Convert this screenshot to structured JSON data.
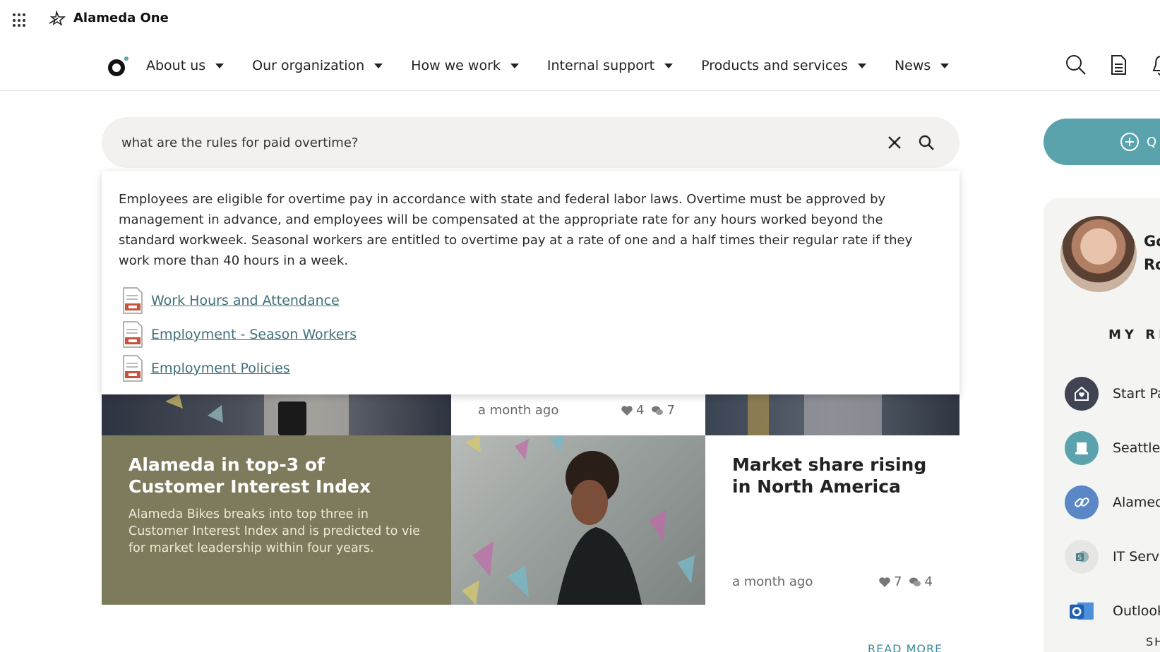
{
  "brand": {
    "name": "Alameda One"
  },
  "nav": {
    "items": [
      {
        "label": "About us"
      },
      {
        "label": "Our organization"
      },
      {
        "label": "How we work"
      },
      {
        "label": "Internal support"
      },
      {
        "label": "Products and services"
      },
      {
        "label": "News"
      }
    ],
    "icons": [
      "search-icon",
      "document-icon",
      "bell-icon"
    ]
  },
  "search": {
    "query": "what are the rules for paid overtime?",
    "answer": "Employees are eligible for overtime pay in accordance with state and federal labor laws. Overtime must be approved by management in advance, and employees will be compensated at the appropriate rate for any hours worked beyond the standard workweek. Seasonal workers are entitled to overtime pay at a rate of one and a half times their regular rate if they work more than 40 hours in a week.",
    "sources": [
      {
        "title": "Work Hours and Attendance"
      },
      {
        "title": "Employment - Season Workers"
      },
      {
        "title": "Employment Policies"
      }
    ]
  },
  "news": {
    "top_middle": {
      "time": "a month ago",
      "likes": "4",
      "comments": "7"
    },
    "olive": {
      "title": "Alameda in top-3 of Customer Interest Index",
      "summary": "Alameda Bikes breaks into top three in Customer Interest Index and is predicted to vie for market leadership within four years."
    },
    "right": {
      "title": "Market share rising in North America",
      "time": "a month ago",
      "likes": "7",
      "comments": "4"
    },
    "read_more": "READ MORE"
  },
  "sidebar": {
    "quick_button_label": "Q",
    "profile_name_line1": "Go",
    "profile_name_line2": "Ro",
    "my_resources_heading": "MY RE",
    "resources": [
      {
        "label": "Start Pa",
        "icon": "home-heart-icon",
        "color": "#3f4352"
      },
      {
        "label": "Seattle",
        "icon": "building-icon",
        "color": "#5aa3ad"
      },
      {
        "label": "Alamed",
        "icon": "link-icon",
        "color": "#5b87c7"
      },
      {
        "label": "IT Servi",
        "icon": "sharepoint-icon",
        "color": "#e6e6e4"
      },
      {
        "label": "Outlook",
        "icon": "outlook-icon",
        "color": "#f4f4f2"
      }
    ],
    "show_more": "SH"
  },
  "colors": {
    "accent": "#5aa3ad",
    "olive_tile": "#7e7b5d",
    "link": "#3f6f7a"
  }
}
